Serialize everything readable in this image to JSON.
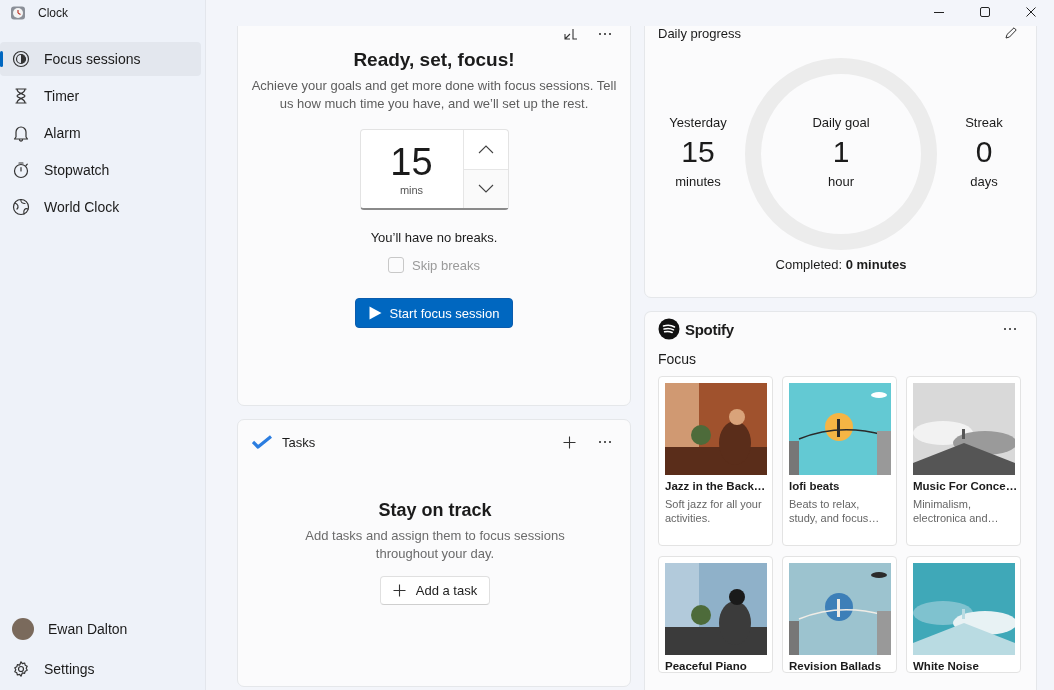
{
  "window": {
    "title": "Clock"
  },
  "sidebar": {
    "items": [
      {
        "label": "Focus sessions",
        "kind": "focus",
        "selected": true
      },
      {
        "label": "Timer",
        "kind": "timer",
        "selected": false
      },
      {
        "label": "Alarm",
        "kind": "alarm",
        "selected": false
      },
      {
        "label": "Stopwatch",
        "kind": "stopwatch",
        "selected": false
      },
      {
        "label": "World Clock",
        "kind": "world",
        "selected": false
      }
    ],
    "account": {
      "name": "Ewan Dalton"
    },
    "settings": {
      "label": "Settings"
    }
  },
  "focus": {
    "title": "Ready, set, focus!",
    "description": "Achieve your goals and get more done with focus sessions. Tell us how much time you have, and we’ll set up the rest.",
    "duration": {
      "value": "15",
      "unit": "mins"
    },
    "breaks_note": "You’ll have no breaks.",
    "skip_breaks": {
      "label": "Skip breaks",
      "checked": false,
      "disabled": true
    },
    "start_button": "Start focus session"
  },
  "tasks": {
    "title": "Tasks",
    "empty_title": "Stay on track",
    "empty_text": "Add tasks and assign them to focus sessions throughout your day.",
    "add_button": "Add a task"
  },
  "daily_progress": {
    "title": "Daily progress",
    "stats": [
      {
        "label": "Yesterday",
        "value": "15",
        "unit": "minutes"
      },
      {
        "label": "Daily goal",
        "value": "1",
        "unit": "hour"
      },
      {
        "label": "Streak",
        "value": "0",
        "unit": "days"
      }
    ],
    "completed": "Completed: **0 minutes**"
  },
  "spotify": {
    "brand": "Spotify",
    "section": "Focus",
    "playlists": [
      {
        "title": "Jazz in the Back…",
        "description": "Soft jazz for all your activities."
      },
      {
        "title": "lofi beats",
        "description": "Beats to relax, study, and focus…"
      },
      {
        "title": "Music For Conce…",
        "description": "Minimalism, electronica and…"
      },
      {
        "title": "Peaceful Piano"
      },
      {
        "title": "Revision Ballads"
      },
      {
        "title": "White Noise"
      }
    ]
  }
}
